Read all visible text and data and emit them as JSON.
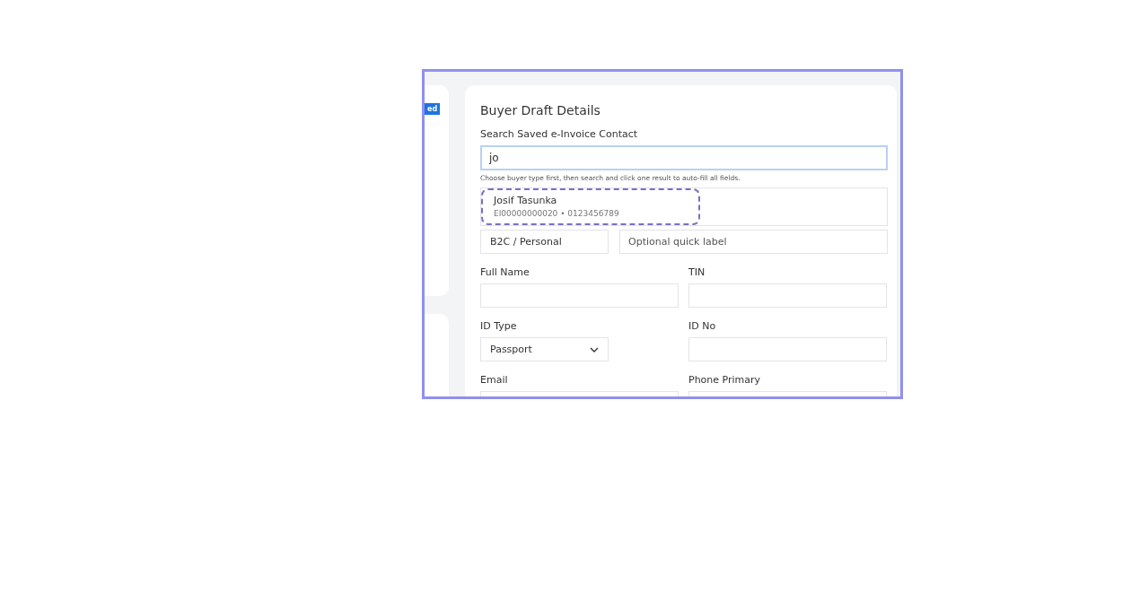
{
  "left_panel": {
    "badge": "ed"
  },
  "buyer_form": {
    "title": "Buyer Draft Details",
    "search": {
      "label": "Search Saved e-Invoice Contact",
      "value": "jo",
      "hint": "Choose buyer type first, then search and click one result to auto-fill all fields."
    },
    "search_results": [
      {
        "name": "Josif Tasunka",
        "detail": "EI00000000020 • 0123456789"
      }
    ],
    "buyer_type": {
      "value": "B2C / Personal"
    },
    "quick_label": {
      "placeholder": "Optional quick label"
    },
    "rows": [
      [
        {
          "label": "Full Name",
          "kind": "text"
        },
        {
          "label": "TIN",
          "kind": "text"
        }
      ],
      [
        {
          "label": "ID Type",
          "kind": "select",
          "value": "Passport"
        },
        {
          "label": "ID No",
          "kind": "text"
        }
      ],
      [
        {
          "label": "Email",
          "kind": "text"
        },
        {
          "label": "Phone Primary",
          "kind": "text"
        }
      ]
    ]
  }
}
